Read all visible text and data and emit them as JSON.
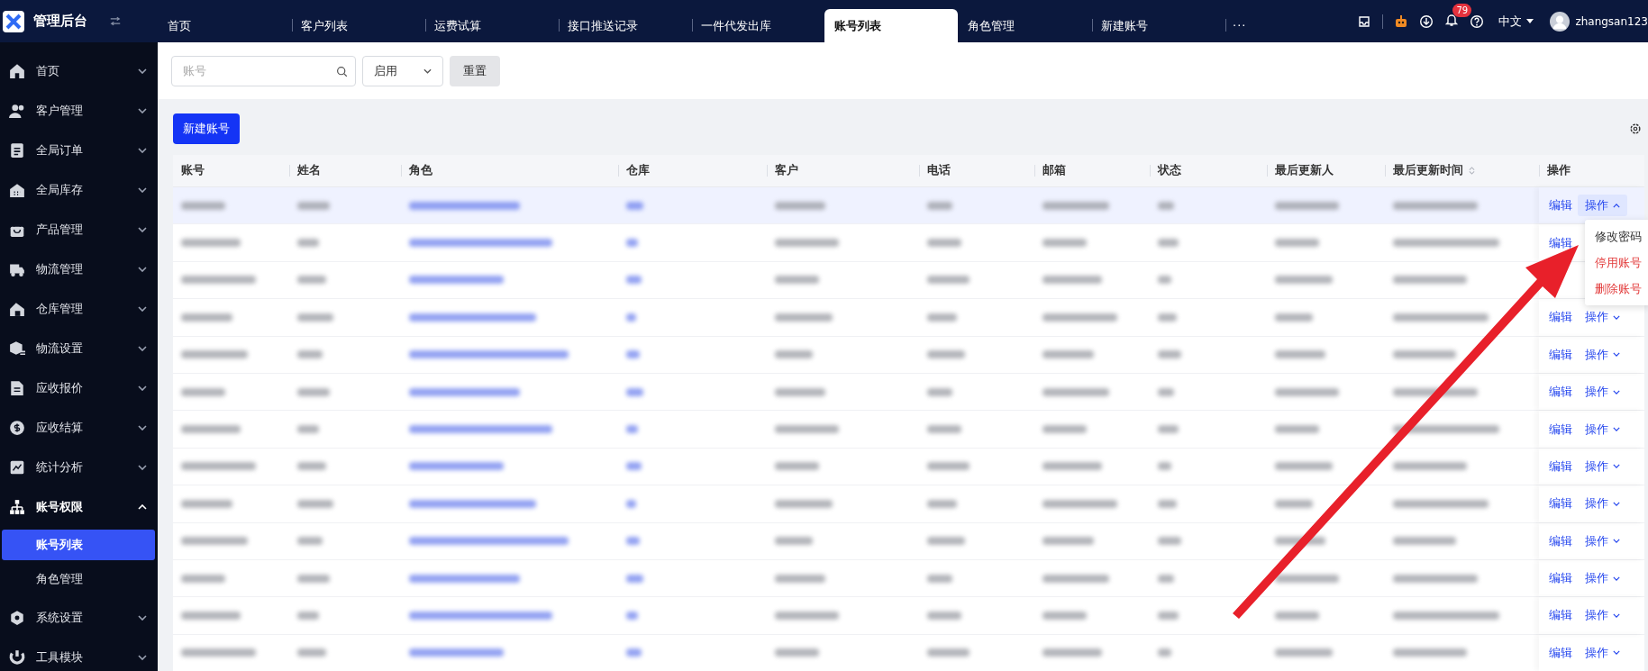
{
  "header": {
    "title": "管理后台",
    "tabs": [
      {
        "label": "首页",
        "selected": false
      },
      {
        "label": "客户列表",
        "selected": false
      },
      {
        "label": "运费试算",
        "selected": false
      },
      {
        "label": "接口推送记录",
        "selected": false
      },
      {
        "label": "一件代发出库",
        "selected": false
      },
      {
        "label": "账号列表",
        "selected": true
      },
      {
        "label": "角色管理",
        "selected": false
      },
      {
        "label": "新建账号",
        "selected": false
      }
    ],
    "more": "···",
    "notifications": "79",
    "language": "中文",
    "user": "zhangsan123"
  },
  "sidebar": {
    "items": [
      {
        "label": "首页",
        "expanded": false
      },
      {
        "label": "客户管理",
        "expanded": false
      },
      {
        "label": "全局订单",
        "expanded": false
      },
      {
        "label": "全局库存",
        "expanded": false
      },
      {
        "label": "产品管理",
        "expanded": false
      },
      {
        "label": "物流管理",
        "expanded": false
      },
      {
        "label": "仓库管理",
        "expanded": false
      },
      {
        "label": "物流设置",
        "expanded": false
      },
      {
        "label": "应收报价",
        "expanded": false
      },
      {
        "label": "应收结算",
        "expanded": false
      },
      {
        "label": "统计分析",
        "expanded": false
      },
      {
        "label": "账号权限",
        "expanded": true,
        "children": [
          {
            "label": "账号列表",
            "selected": true
          },
          {
            "label": "角色管理",
            "selected": false
          }
        ]
      },
      {
        "label": "系统设置",
        "expanded": false
      },
      {
        "label": "工具模块",
        "expanded": false
      }
    ]
  },
  "filters": {
    "search": {
      "placeholder": "账号"
    },
    "status": "启用",
    "reset": "重置"
  },
  "create_button": "新建账号",
  "table": {
    "columns": [
      {
        "label": "账号",
        "kind": "plain"
      },
      {
        "label": "姓名",
        "kind": "plain"
      },
      {
        "label": "角色",
        "kind": "link"
      },
      {
        "label": "仓库",
        "kind": "link"
      },
      {
        "label": "客户",
        "kind": "plain"
      },
      {
        "label": "电话",
        "kind": "plain"
      },
      {
        "label": "邮箱",
        "kind": "plain"
      },
      {
        "label": "状态",
        "kind": "plain"
      },
      {
        "label": "最后更新人",
        "kind": "plain"
      },
      {
        "label": "最后更新时间",
        "kind": "plain",
        "sortable": true
      },
      {
        "label": "操作",
        "kind": "actions"
      }
    ],
    "rows": [
      {
        "selected": true,
        "menu_open": true,
        "edit": "编辑",
        "action": "操作"
      },
      {
        "selected": false,
        "menu_open": false,
        "edit": "编辑"
      },
      {
        "selected": false,
        "menu_open": false
      },
      {
        "selected": false,
        "menu_open": false,
        "edit": "编辑",
        "action": "操作"
      },
      {
        "selected": false,
        "menu_open": false,
        "edit": "编辑",
        "action": "操作"
      },
      {
        "selected": false,
        "menu_open": false,
        "edit": "编辑",
        "action": "操作"
      },
      {
        "selected": false,
        "menu_open": false,
        "edit": "编辑",
        "action": "操作"
      },
      {
        "selected": false,
        "menu_open": false,
        "edit": "编辑",
        "action": "操作"
      },
      {
        "selected": false,
        "menu_open": false,
        "edit": "编辑",
        "action": "操作"
      },
      {
        "selected": false,
        "menu_open": false,
        "edit": "编辑",
        "action": "操作"
      },
      {
        "selected": false,
        "menu_open": false,
        "edit": "编辑",
        "action": "操作"
      },
      {
        "selected": false,
        "menu_open": false,
        "edit": "编辑",
        "action": "操作"
      },
      {
        "selected": false,
        "menu_open": false,
        "edit": "编辑",
        "action": "操作"
      }
    ]
  },
  "action_menu": [
    {
      "label": "修改密码",
      "danger": false
    },
    {
      "label": "停用账号",
      "danger": true
    },
    {
      "label": "删除账号",
      "danger": true
    }
  ]
}
